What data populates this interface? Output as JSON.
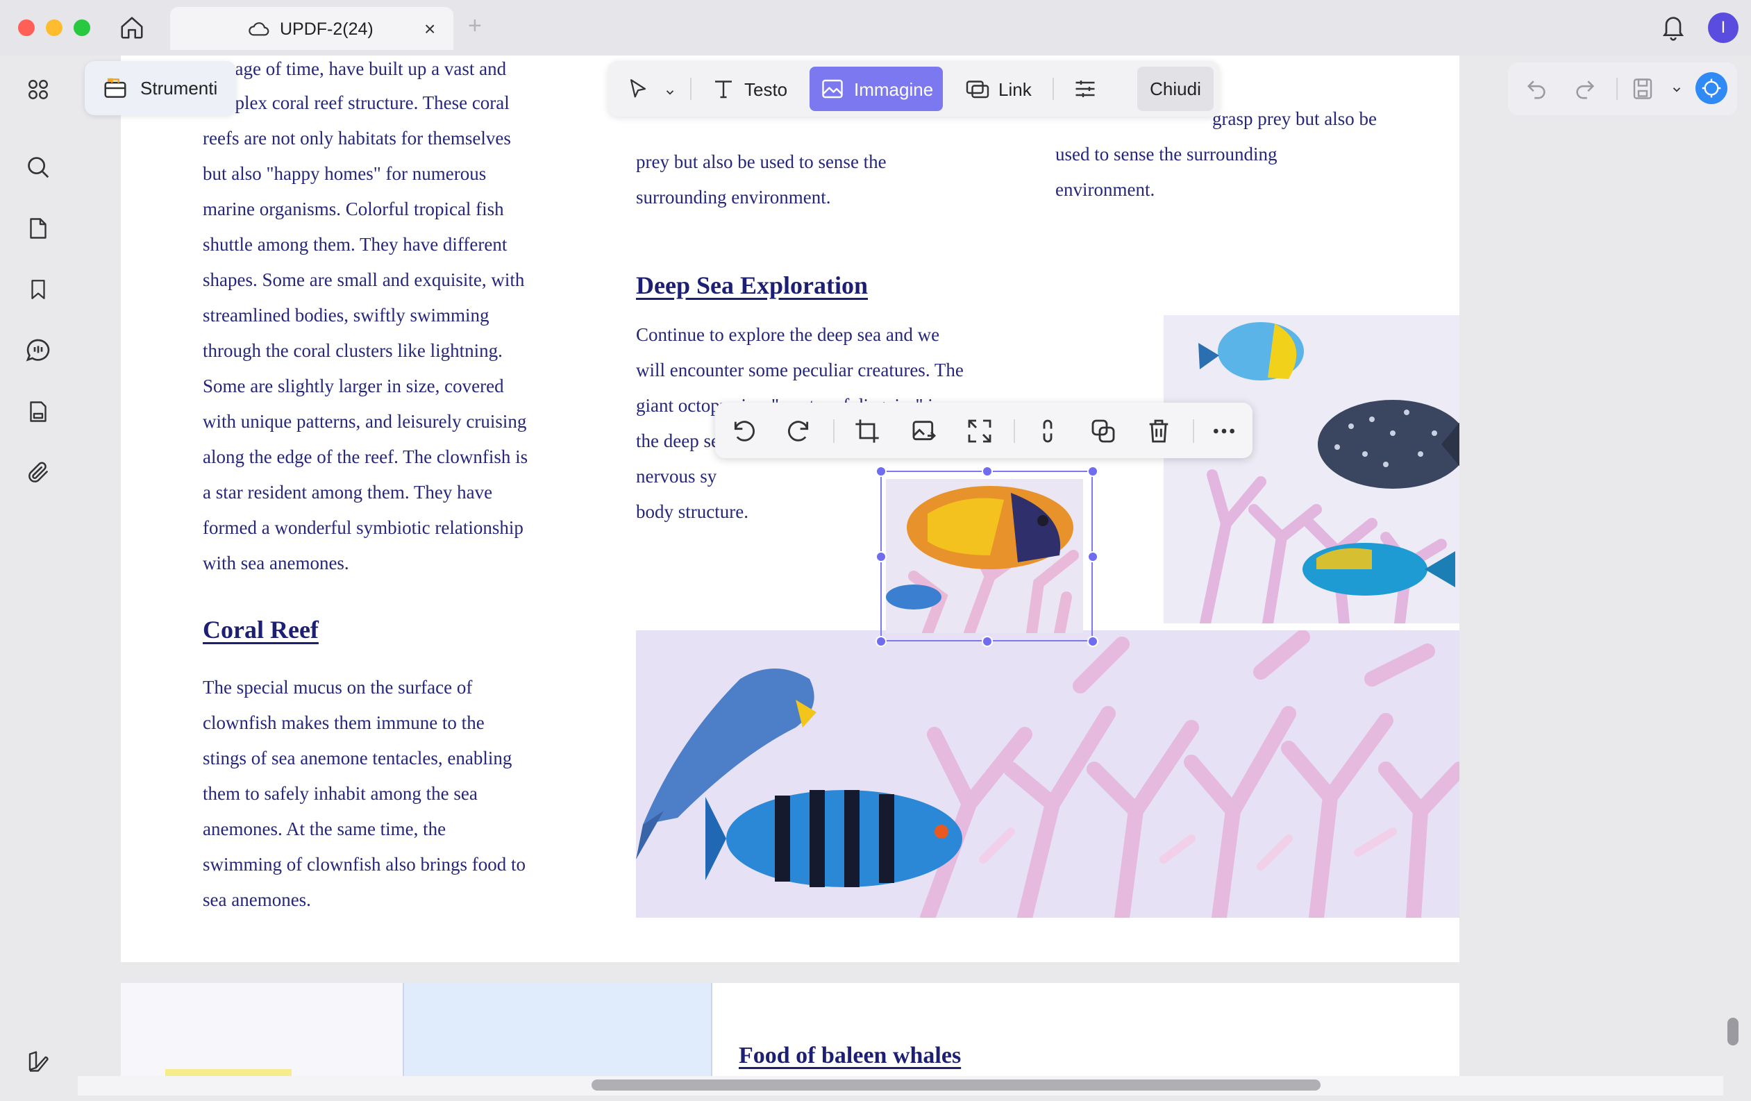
{
  "window": {
    "tab_title": "UPDF-2(24)",
    "tab_close": "×",
    "tab_add": "+",
    "avatar_initial": "I"
  },
  "toolbar": {
    "strumenti_label": "Strumenti",
    "text_label": "Testo",
    "image_label": "Immagine",
    "link_label": "Link",
    "close_label": "Chiudi"
  },
  "document": {
    "left_column": [
      "passage of time, have built up a vast and",
      "complex coral reef structure. These coral",
      "reefs are not only habitats for themselves",
      "but also \"happy homes\" for numerous",
      "marine organisms. Colorful tropical fish",
      "shuttle among them. They have different",
      "shapes. Some are small and exquisite, with",
      "streamlined bodies, swiftly swimming",
      "through the coral clusters like lightning.",
      "Some are slightly larger in size, covered",
      "with unique patterns, and leisurely cruising",
      "along the edge of the reef. The clownfish is",
      "a star resident among them. They have",
      "formed a wonderful symbiotic relationship",
      "with sea anemones."
    ],
    "coral_heading": "Coral Reef",
    "coral_paragraph": [
      " The special mucus on the surface of",
      "clownfish makes them immune to the",
      "stings of sea anemone tentacles, enabling",
      "them to safely inhabit among the sea",
      "anemones. At the same time, the",
      "swimming of clownfish also brings food to",
      "sea anemones."
    ],
    "middle_top": [
      "prey but also be used to sense the",
      "surrounding environment."
    ],
    "deep_sea_heading": "Deep Sea Exploration",
    "deep_sea_paragraph": [
      "Continue to explore the deep sea and we",
      "will encounter some peculiar creatures. The",
      "giant octopus is a \"master of disguise\" in",
      "the deep sea",
      "nervous sy",
      "body structure."
    ],
    "right_top": [
      "grasp prey but also be",
      "used to sense the surrounding",
      "environment."
    ],
    "baleen_heading": "Food of baleen whales"
  },
  "colors": {
    "accent": "#7b78f0",
    "text": "#26277a",
    "heading": "#1d1f72"
  }
}
